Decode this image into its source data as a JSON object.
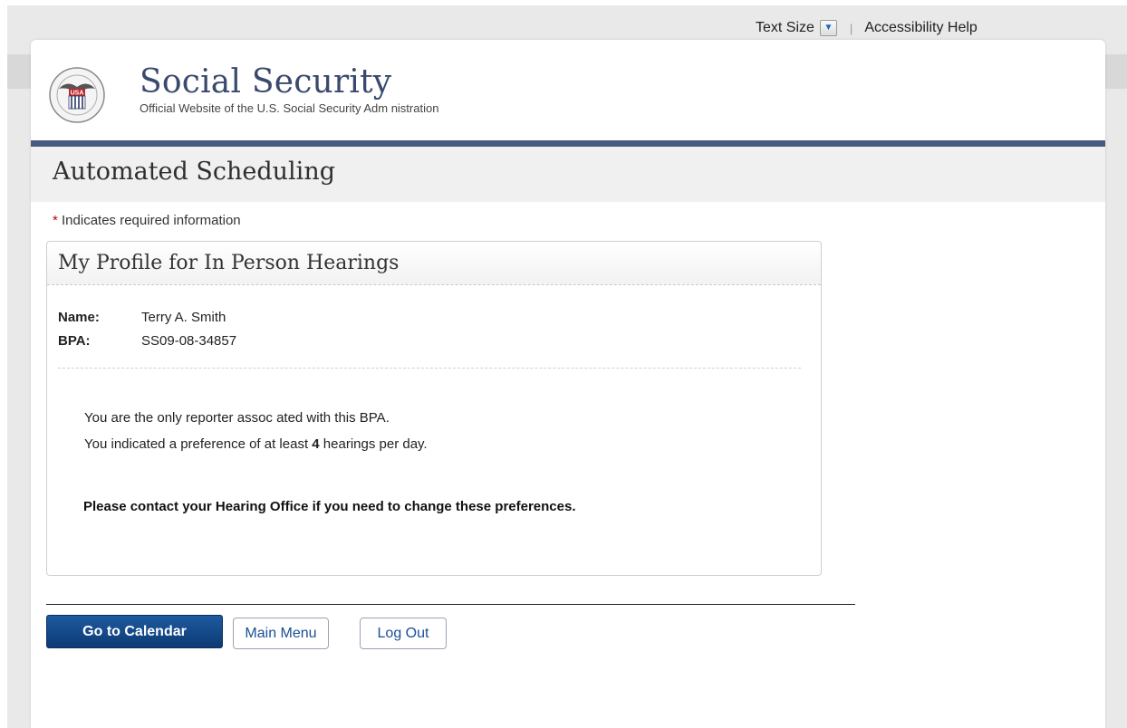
{
  "utility": {
    "text_size_label": "Text Size",
    "accessibility_label": "Accessibility Help"
  },
  "header": {
    "logo_label": "USA",
    "site_title": "Social Security",
    "site_subtitle": "Official Website of the U.S. Social Security Adm nistration"
  },
  "app": {
    "title": "Automated Scheduling",
    "required_star": "*",
    "required_note": "Indicates required information"
  },
  "profile": {
    "title": "My Profile for In Person Hearings",
    "name_label": "Name:",
    "name_value": "Terry A. Smith",
    "bpa_label": "BPA:",
    "bpa_value": "SS09-08-34857",
    "message1": "You are the only reporter assoc ated with this BPA.",
    "message2_pre": "You indicated a preference of at least ",
    "message2_bold": "4",
    "message2_post": " hearings per day.",
    "contact_note": "Please contact your Hearing Office if you need to change these preferences."
  },
  "actions": {
    "go_calendar": "Go to Calendar",
    "main_menu": "Main Menu",
    "log_out": "Log Out"
  },
  "colors": {
    "brand_navy": "#475a7f",
    "title_text": "#3a4a6e",
    "primary_button": "#0c3a73",
    "required_star": "#c00000"
  }
}
